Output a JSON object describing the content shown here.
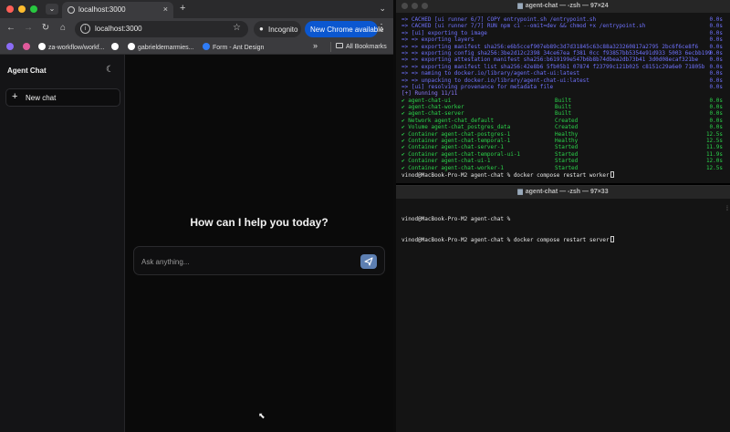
{
  "browser": {
    "tab_title": "localhost:3000",
    "url": "localhost:3000",
    "incognito_label": "Incognito",
    "update_label": "New Chrome available",
    "bookmarks": [
      {
        "label": "",
        "color": "#8b6cf6"
      },
      {
        "label": "",
        "color": "#e05a9c"
      },
      {
        "label": "za-workflow/workf...",
        "color": "#ffffff"
      },
      {
        "label": "",
        "color": "#ffffff"
      },
      {
        "label": "gabrieldemarmies...",
        "color": "#ffffff"
      },
      {
        "label": "Form - Ant Design",
        "color": "#2f7cf6"
      }
    ],
    "more_bookmarks": "»",
    "all_bookmarks": "All Bookmarks"
  },
  "app": {
    "brand": "Agent Chat",
    "new_chat_label": "New chat",
    "greeting": "How can I help you today?",
    "input_placeholder": "Ask anything..."
  },
  "terminal_top": {
    "title": "agent-chat — -zsh — 97×24",
    "lines": [
      {
        "text": "=> CACHED [ui runner 6/7] COPY entrypoint.sh /entrypoint.sh",
        "value": "0.0s",
        "color": "blue"
      },
      {
        "text": "=> CACHED [ui runner 7/7] RUN npm ci --omit=dev && chmod +x /entrypoint.sh",
        "value": "0.0s",
        "color": "blue"
      },
      {
        "text": "=> [ui] exporting to image",
        "value": "0.0s",
        "color": "blue"
      },
      {
        "text": "=> => exporting layers",
        "value": "0.0s",
        "color": "blue"
      },
      {
        "text": "=> => exporting manifest sha256:e6b5ccef907eb89c3d7d31845c63c88a323260817a2795 2bc6f6ce8f6",
        "value": "0.0s",
        "color": "blue"
      },
      {
        "text": "=> => exporting config sha256:3be2d12c2398 34ce67ea f381 0cc f93857bb5354e91d933 5003 6ecbb199",
        "value": "0.0s",
        "color": "blue"
      },
      {
        "text": "=> => exporting attestation manifest sha256:b619199e547b6b8b74dbea2db73b41 3d0d08ecaf321be",
        "value": "0.0s",
        "color": "blue"
      },
      {
        "text": "=> => exporting manifest list sha256:42e8b6 5fb05b1 07874 f23799c121b025 c8151c29a6e0 71805b",
        "value": "0.0s",
        "color": "blue"
      },
      {
        "text": "=> => naming to docker.io/library/agent-chat-ui:latest",
        "value": "0.0s",
        "color": "blue"
      },
      {
        "text": "=> => unpacking to docker.io/library/agent-chat-ui:latest",
        "value": "0.0s",
        "color": "blue"
      },
      {
        "text": "=> [ui] resolving provenance for metadata file",
        "value": "0.0s",
        "color": "blue"
      },
      {
        "text": "[+] Running 11/11",
        "value": "",
        "color": "purple"
      },
      {
        "text": "✔ agent-chat-ui",
        "status": "Built",
        "value": "0.0s",
        "color": "green"
      },
      {
        "text": "✔ agent-chat-worker",
        "status": "Built",
        "value": "0.0s",
        "color": "green"
      },
      {
        "text": "✔ agent-chat-server",
        "status": "Built",
        "value": "0.0s",
        "color": "green"
      },
      {
        "text": "✔ Network agent-chat_default",
        "status": "Created",
        "value": "0.0s",
        "color": "green"
      },
      {
        "text": "✔ Volume agent-chat_postgres_data",
        "status": "Created",
        "value": "0.0s",
        "color": "green"
      },
      {
        "text": "✔ Container agent-chat-postgres-1",
        "status": "Healthy",
        "value": "12.5s",
        "color": "green"
      },
      {
        "text": "✔ Container agent-chat-temporal-1",
        "status": "Healthy",
        "value": "12.5s",
        "color": "green"
      },
      {
        "text": "✔ Container agent-chat-server-1",
        "status": "Started",
        "value": "11.9s",
        "color": "green"
      },
      {
        "text": "✔ Container agent-chat-temporal-ui-1",
        "status": "Started",
        "value": "11.9s",
        "color": "green"
      },
      {
        "text": "✔ Container agent-chat-ui-1",
        "status": "Started",
        "value": "12.0s",
        "color": "green"
      },
      {
        "text": "✔ Container agent-chat-worker-1",
        "status": "Started",
        "value": "12.5s",
        "color": "green"
      }
    ],
    "prompt": "vinod@MacBook-Pro-M2 agent-chat % docker compose restart worker"
  },
  "terminal_bottom": {
    "title": "agent-chat — -zsh — 97×33",
    "lines": [
      "vinod@MacBook-Pro-M2 agent-chat %",
      "vinod@MacBook-Pro-M2 agent-chat % docker compose restart server"
    ]
  },
  "colors": {
    "blue": "#6f72ff",
    "purple": "#8e7bff",
    "green": "#2bd34a",
    "send_button": "#5d7fb2"
  }
}
